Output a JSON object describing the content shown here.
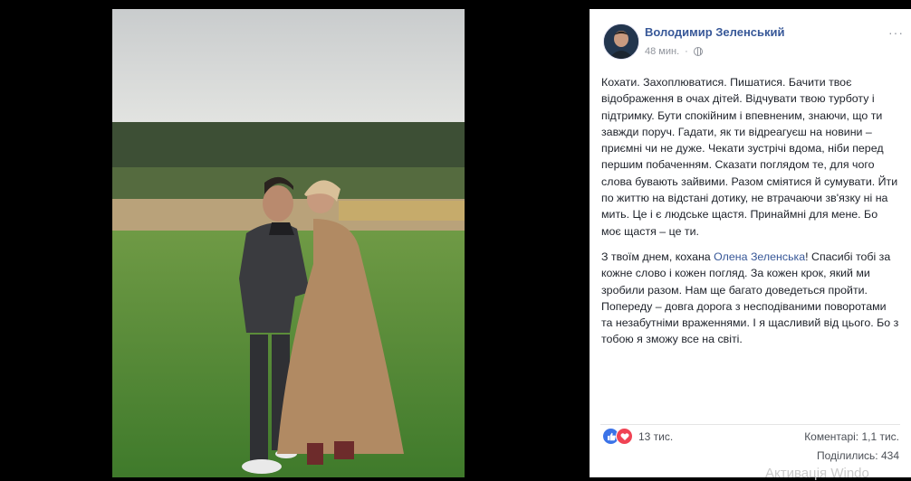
{
  "post": {
    "author": "Володимир Зеленський",
    "time": "48 мин.",
    "more": "···",
    "paragraph1": "Кохати. Захоплюватися. Пишатися. Бачити твоє відображення в очах дітей. Відчувати твою турботу і підтримку. Бути спокійним і впевненим, знаючи, що ти завжди поруч. Гадати, як ти відреагуєш на новини – приємні чи не дуже. Чекати зустрічі вдома, ніби перед першим побаченням. Сказати поглядом те, для чого слова бувають зайвими. Разом сміятися й сумувати. Йти по життю на відстані дотику, не втрачаючи зв'язку ні на мить. Це і є людське щастя. Принаймні для мене. Бо моє щастя – це ти.",
    "paragraph2_start": "З твоїм днем, кохана ",
    "mention": "Олена Зеленська",
    "paragraph2_end": "! Спасибі тобі за кожне слово і кожен погляд. За кожен крок, який ми зробили разом. Нам ще багато доведеться пройти. Попереду – довга дорога з несподіваними поворотами та незабутніми враженнями. І я щасливий від цього. Бо з тобою я зможу все на світі."
  },
  "footer": {
    "reactions_count": "13 тис.",
    "comments": "Коментарі: 1,1 тис.",
    "shares": "Поділились: 434"
  },
  "icons": {
    "like": "like-icon",
    "love": "love-icon",
    "privacy": "globe-icon"
  },
  "colors": {
    "link": "#385898",
    "like": "#3b73e8",
    "love": "#f04354"
  },
  "overlay": {
    "watermark": "Активація Windo"
  }
}
